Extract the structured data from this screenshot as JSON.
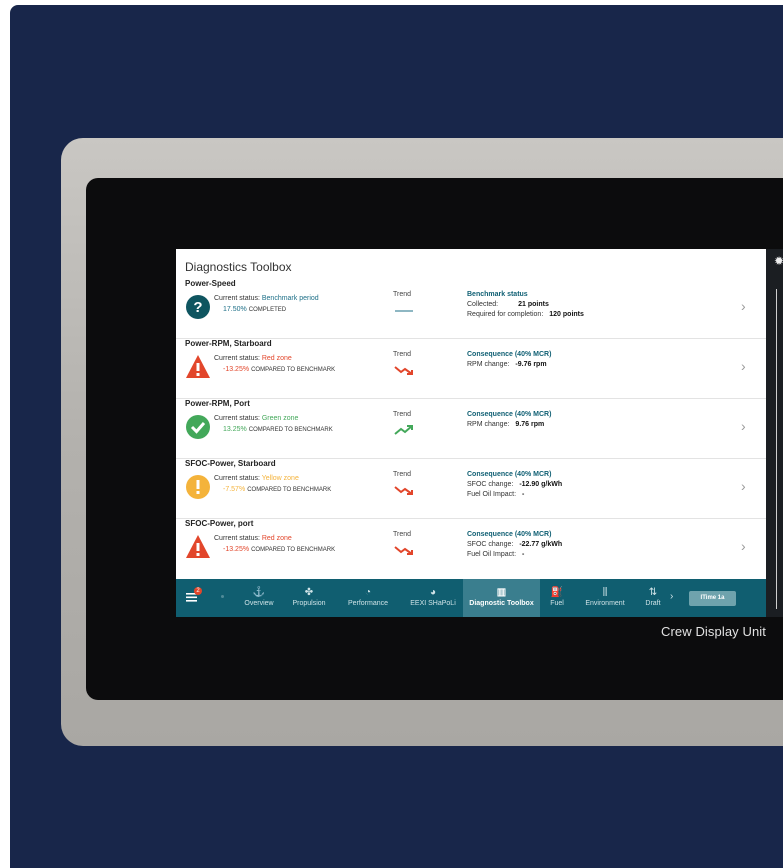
{
  "device": {
    "label": "Crew Display Unit"
  },
  "app": {
    "title": "Diagnostics Toolbox"
  },
  "rows": [
    {
      "name": "Power-Speed",
      "status_prefix": "Current status: ",
      "status_value": "Benchmark period",
      "status_color": "#1d6f87",
      "pct": "17.50%",
      "pct_suffix": "COMPLETED",
      "trend_label": "Trend",
      "trend": "flat",
      "icon": "question-icon",
      "info_title": "Benchmark status",
      "info": [
        {
          "label": "Collected:",
          "value": "21 points"
        },
        {
          "label": "Required for completion:",
          "value": "120 points"
        }
      ]
    },
    {
      "name": "Power-RPM, Starboard",
      "status_prefix": "Current status: ",
      "status_value": "Red zone",
      "status_color": "#e2462b",
      "pct": "-13.25%",
      "pct_suffix": "COMPARED TO BENCHMARK",
      "trend_label": "Trend",
      "trend": "down",
      "icon": "warning-icon",
      "info_title": "Consequence (40% MCR)",
      "info": [
        {
          "label": "RPM change:",
          "value": "-9.76 rpm"
        }
      ]
    },
    {
      "name": "Power-RPM, Port",
      "status_prefix": "Current status: ",
      "status_value": "Green zone",
      "status_color": "#43a85a",
      "pct": "13.25%",
      "pct_suffix": "COMPARED TO BENCHMARK",
      "trend_label": "Trend",
      "trend": "up",
      "icon": "check-icon",
      "info_title": "Consequence (40% MCR)",
      "info": [
        {
          "label": "RPM change:",
          "value": "9.76 rpm"
        }
      ]
    },
    {
      "name": "SFOC-Power, Starboard",
      "status_prefix": "Current status: ",
      "status_value": "Yellow zone",
      "status_color": "#f4b33b",
      "pct": "-7.57%",
      "pct_suffix": "COMPARED TO BENCHMARK",
      "trend_label": "Trend",
      "trend": "down",
      "icon": "exclamation-icon",
      "info_title": "Consequence (40% MCR)",
      "info": [
        {
          "label": "SFOC change:",
          "value": "-12.90 g/kWh"
        },
        {
          "label": "Fuel Oil Impact:",
          "value": "-"
        }
      ]
    },
    {
      "name": "SFOC-Power, port",
      "status_prefix": "Current status: ",
      "status_value": "Red zone",
      "status_color": "#e2462b",
      "pct": "-13.25%",
      "pct_suffix": "COMPARED TO BENCHMARK",
      "trend_label": "Trend",
      "trend": "down",
      "icon": "warning-icon",
      "info_title": "Consequence (40% MCR)",
      "info": [
        {
          "label": "SFOC change:",
          "value": "-22.77 g/kWh"
        },
        {
          "label": "Fuel Oil Impact:",
          "value": "-"
        }
      ]
    }
  ],
  "nav": {
    "badge": "2",
    "items": [
      {
        "label": "Overview",
        "icon": "overview-icon",
        "active": false
      },
      {
        "label": "Propulsion",
        "icon": "propeller-icon",
        "active": false
      },
      {
        "label": "Performance",
        "icon": "gauge-icon",
        "active": false
      },
      {
        "label": "EEXI SHaPoLi",
        "icon": "speedometer-icon",
        "active": false
      },
      {
        "label": "Diagnostic Toolbox",
        "icon": "chart-icon",
        "active": true
      },
      {
        "label": "Fuel",
        "icon": "fuel-icon",
        "active": false
      },
      {
        "label": "Environment",
        "icon": "environment-icon",
        "active": false
      },
      {
        "label": "Draft",
        "icon": "draft-icon",
        "active": false
      }
    ],
    "time_label": "ITime 1a"
  },
  "colors": {
    "nav_bg": "#105e70",
    "accent": "#1d6f87",
    "red": "#e2462b",
    "green": "#43a85a",
    "yellow": "#f4b33b"
  }
}
